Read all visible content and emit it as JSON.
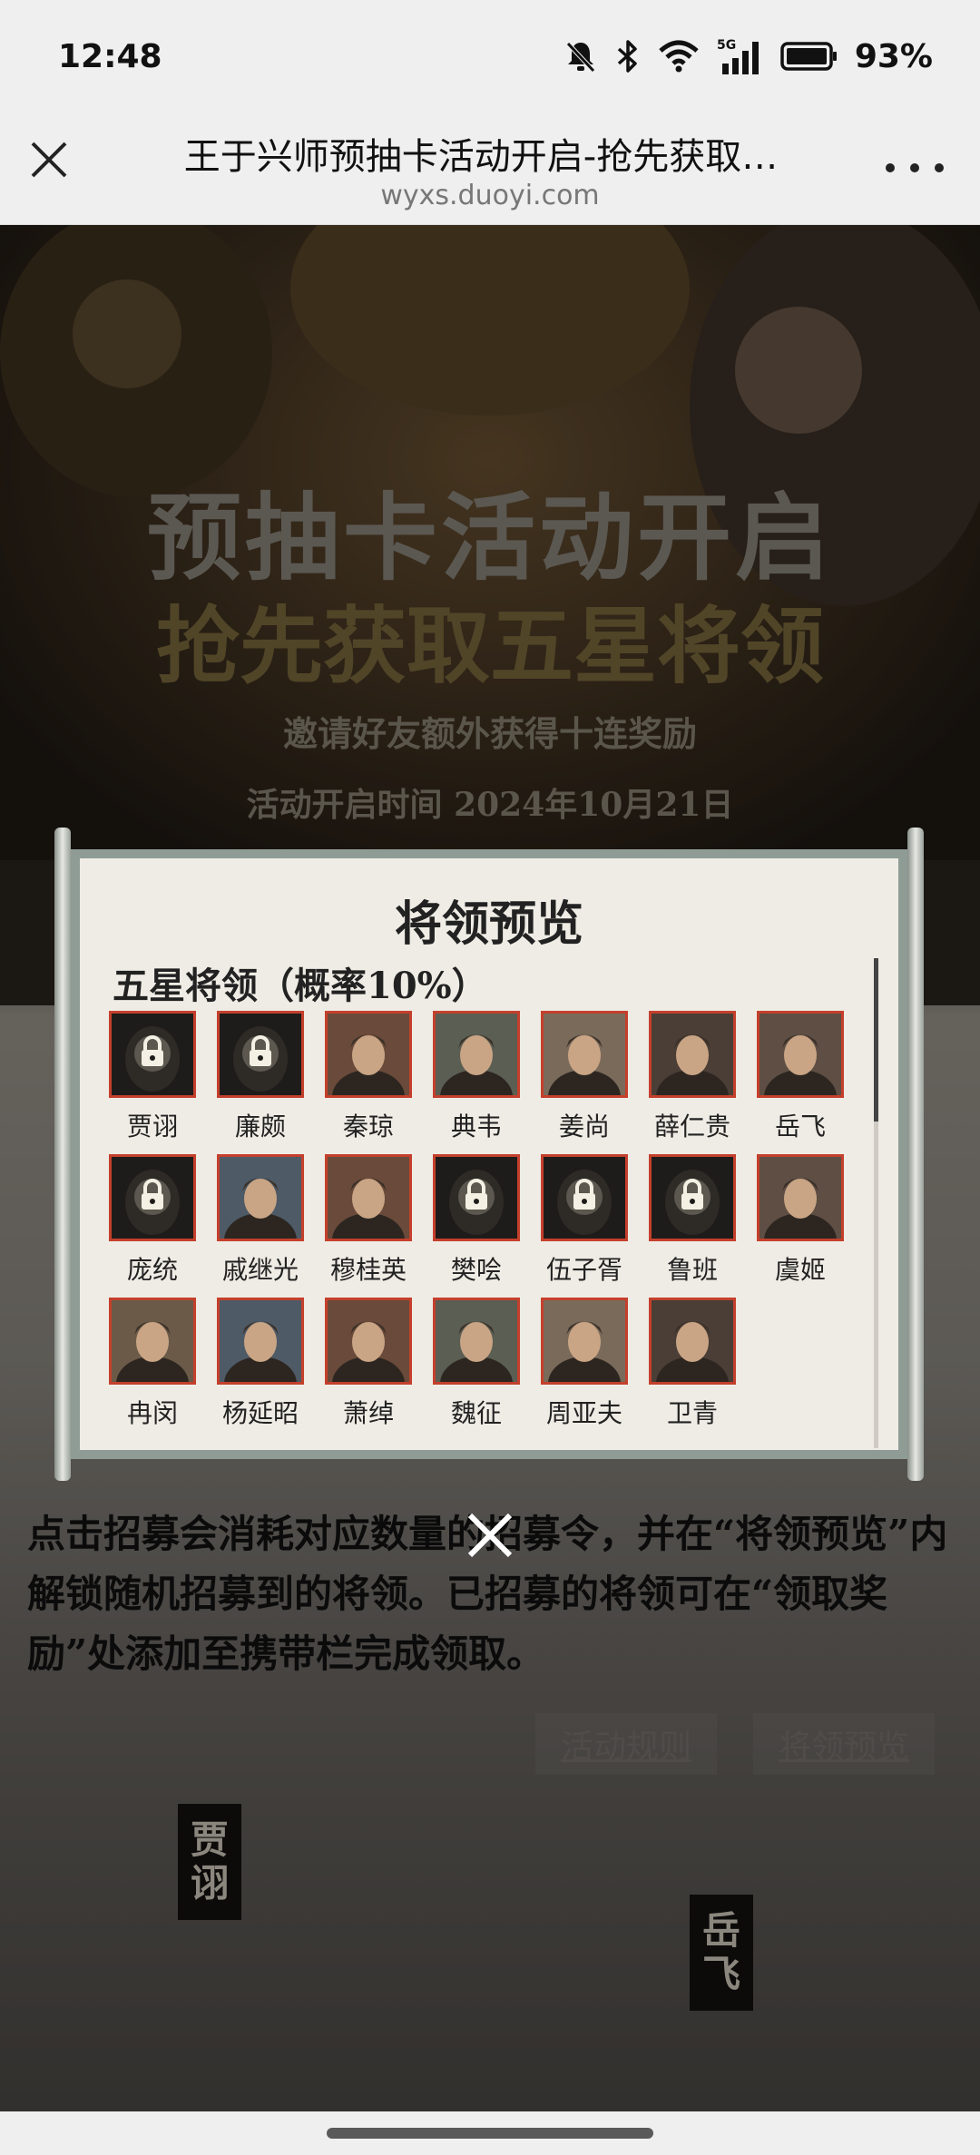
{
  "status_bar": {
    "time": "12:48",
    "battery": "93%",
    "icons": [
      "bell-off-icon",
      "bluetooth-icon",
      "wifi-icon",
      "signal-5g-icon",
      "battery-icon"
    ]
  },
  "browser": {
    "title": "王于兴师预抽卡活动开启-抢先获取…",
    "url": "wyxs.duoyi.com",
    "close_icon": "close-icon",
    "menu_icon": "more-icon"
  },
  "hero": {
    "line1": "预抽卡活动开启",
    "line2": "抢先获取五星将领",
    "line3": "邀请好友额外获得十连奖励",
    "line4": "活动开启时间 2024年10月21日"
  },
  "modal": {
    "title": "将领预览",
    "section_title": "五星将领（概率10%）",
    "generals": [
      {
        "name": "贾诩",
        "locked": true
      },
      {
        "name": "廉颇",
        "locked": true
      },
      {
        "name": "秦琼",
        "locked": false
      },
      {
        "name": "典韦",
        "locked": false
      },
      {
        "name": "姜尚",
        "locked": false
      },
      {
        "name": "薛仁贵",
        "locked": false
      },
      {
        "name": "岳飞",
        "locked": false
      },
      {
        "name": "庞统",
        "locked": true
      },
      {
        "name": "戚继光",
        "locked": false
      },
      {
        "name": "穆桂英",
        "locked": false
      },
      {
        "name": "樊哙",
        "locked": true
      },
      {
        "name": "伍子胥",
        "locked": true
      },
      {
        "name": "鲁班",
        "locked": true
      },
      {
        "name": "虞姬",
        "locked": false
      },
      {
        "name": "冉闵",
        "locked": false
      },
      {
        "name": "杨延昭",
        "locked": false
      },
      {
        "name": "萧绰",
        "locked": false
      },
      {
        "name": "魏征",
        "locked": false
      },
      {
        "name": "周亚夫",
        "locked": false
      },
      {
        "name": "卫青",
        "locked": false
      }
    ]
  },
  "description": "点击招募会消耗对应数量的招募令，并在“将领预览”内解锁随机招募到的将领。已招募的将领可在“领取奖励”处添加至携带栏完成领取。",
  "links": {
    "rules": "活动规则",
    "preview": "将领预览"
  },
  "side_names": {
    "left": "贾诩",
    "right": "岳飞"
  },
  "colors": {
    "portrait_border": "#c4402c",
    "paper": "#efece5",
    "frame": "#8f9c96"
  }
}
